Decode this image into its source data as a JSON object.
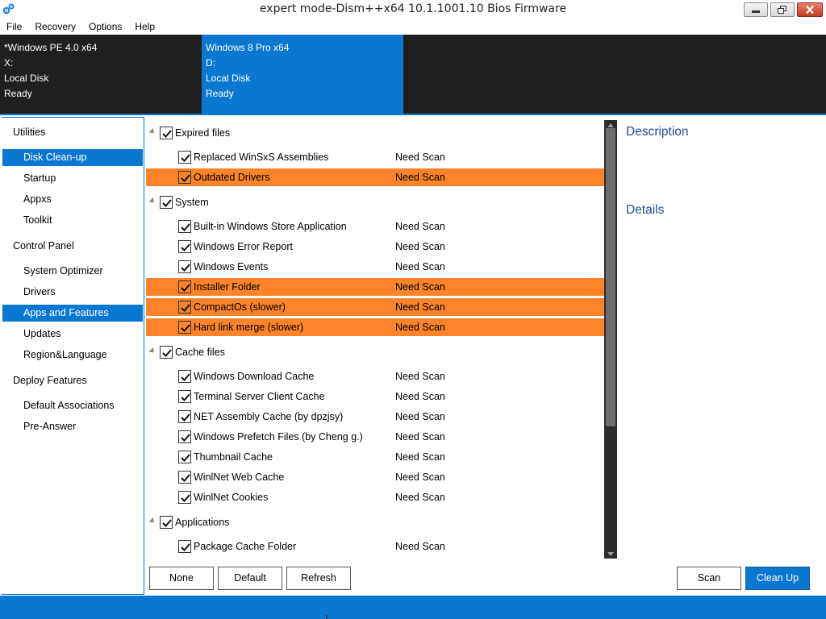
{
  "window": {
    "title": "expert mode-Dism++x64 10.1.1001.10 Bios Firmware",
    "accent_color": "#0a78d0",
    "highlight_color": "#fb8329"
  },
  "menu": [
    "File",
    "Recovery",
    "Options",
    "Help"
  ],
  "images": [
    {
      "name": "*Windows PE 4.0 x64",
      "drive": "X:",
      "disk": "Local Disk",
      "status": "Ready"
    },
    {
      "name": "Windows 8 Pro x64",
      "drive": "D:",
      "disk": "Local Disk",
      "status": "Ready"
    }
  ],
  "sidebar": {
    "groups": [
      {
        "label": "Utilities",
        "items": [
          "Disk Clean-up",
          "Startup",
          "Appxs",
          "Toolkit"
        ]
      },
      {
        "label": "Control Panel",
        "items": [
          "System Optimizer",
          "Drivers",
          "Apps and Features",
          "Updates",
          "Region&Language"
        ]
      },
      {
        "label": "Deploy Features",
        "items": [
          "Default Associations",
          "Pre-Answer"
        ]
      }
    ],
    "active_items": [
      "Disk Clean-up",
      "Apps and Features"
    ]
  },
  "cleanup": {
    "groups": [
      {
        "label": "Expired files",
        "checked": true,
        "items": [
          {
            "label": "Replaced WinSxS Assemblies",
            "status": "Need Scan",
            "checked": true,
            "highlighted": false
          },
          {
            "label": "Outdated Drivers",
            "status": "Need Scan",
            "checked": true,
            "highlighted": true
          }
        ]
      },
      {
        "label": "System",
        "checked": true,
        "items": [
          {
            "label": "Built-in Windows Store Application",
            "status": "Need Scan",
            "checked": true,
            "highlighted": false
          },
          {
            "label": "Windows Error Report",
            "status": "Need Scan",
            "checked": true,
            "highlighted": false
          },
          {
            "label": "Windows Events",
            "status": "Need Scan",
            "checked": true,
            "highlighted": false
          },
          {
            "label": "Installer Folder",
            "status": "Need Scan",
            "checked": true,
            "highlighted": true
          },
          {
            "label": "CompactOs (slower)",
            "status": "Need Scan",
            "checked": true,
            "highlighted": true
          },
          {
            "label": "Hard link merge (slower)",
            "status": "Need Scan",
            "checked": true,
            "highlighted": true
          }
        ]
      },
      {
        "label": "Cache files",
        "checked": true,
        "items": [
          {
            "label": "Windows Download Cache",
            "status": "Need Scan",
            "checked": true,
            "highlighted": false
          },
          {
            "label": "Terminal Server Client Cache",
            "status": "Need Scan",
            "checked": true,
            "highlighted": false
          },
          {
            "label": "NET Assembly Cache (by dpzjsy)",
            "status": "Need Scan",
            "checked": true,
            "highlighted": false
          },
          {
            "label": "Windows Prefetch Files (by Cheng g.)",
            "status": "Need Scan",
            "checked": true,
            "highlighted": false
          },
          {
            "label": "Thumbnail Cache",
            "status": "Need Scan",
            "checked": true,
            "highlighted": false
          },
          {
            "label": "WinlNet Web Cache",
            "status": "Need Scan",
            "checked": true,
            "highlighted": false
          },
          {
            "label": "WinlNet Cookies",
            "status": "Need Scan",
            "checked": true,
            "highlighted": false
          }
        ]
      },
      {
        "label": "Applications",
        "checked": true,
        "items": [
          {
            "label": "Package Cache Folder",
            "status": "Need Scan",
            "checked": true,
            "highlighted": false
          }
        ]
      }
    ]
  },
  "description": {
    "title": "Description",
    "details_title": "Details"
  },
  "buttons": {
    "none": "None",
    "default": "Default",
    "refresh": "Refresh",
    "scan": "Scan",
    "cleanup": "Clean Up"
  }
}
